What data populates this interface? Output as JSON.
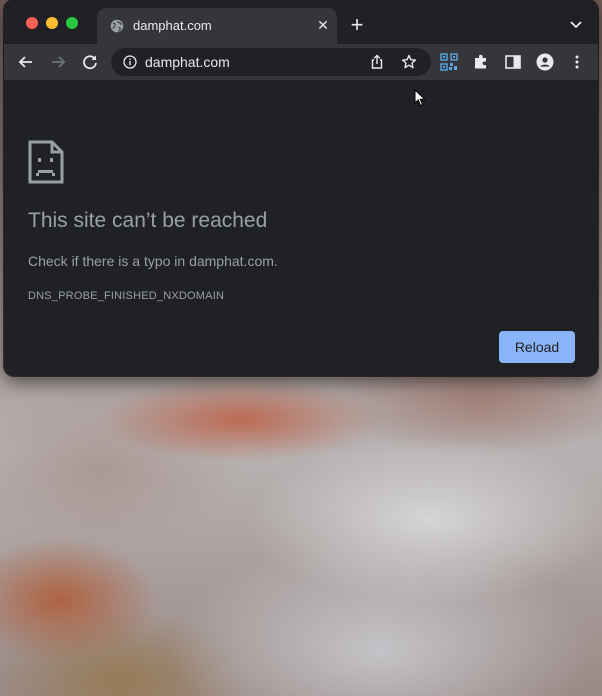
{
  "window": {
    "tab": {
      "title": "damphat.com",
      "favicon": "globe-icon"
    },
    "toolbar": {
      "url": "damphat.com"
    }
  },
  "error_page": {
    "icon": "sad-page-icon",
    "title": "This site can’t be reached",
    "description": "Check if there is a typo in damphat.com.",
    "error_code": "DNS_PROBE_FINISHED_NXDOMAIN",
    "reload_label": "Reload"
  },
  "colors": {
    "background": "#202124",
    "toolbar": "#35363a",
    "accent_button": "#8ab4f8",
    "text_muted": "#9aa0a6",
    "text": "#e8eaed"
  }
}
